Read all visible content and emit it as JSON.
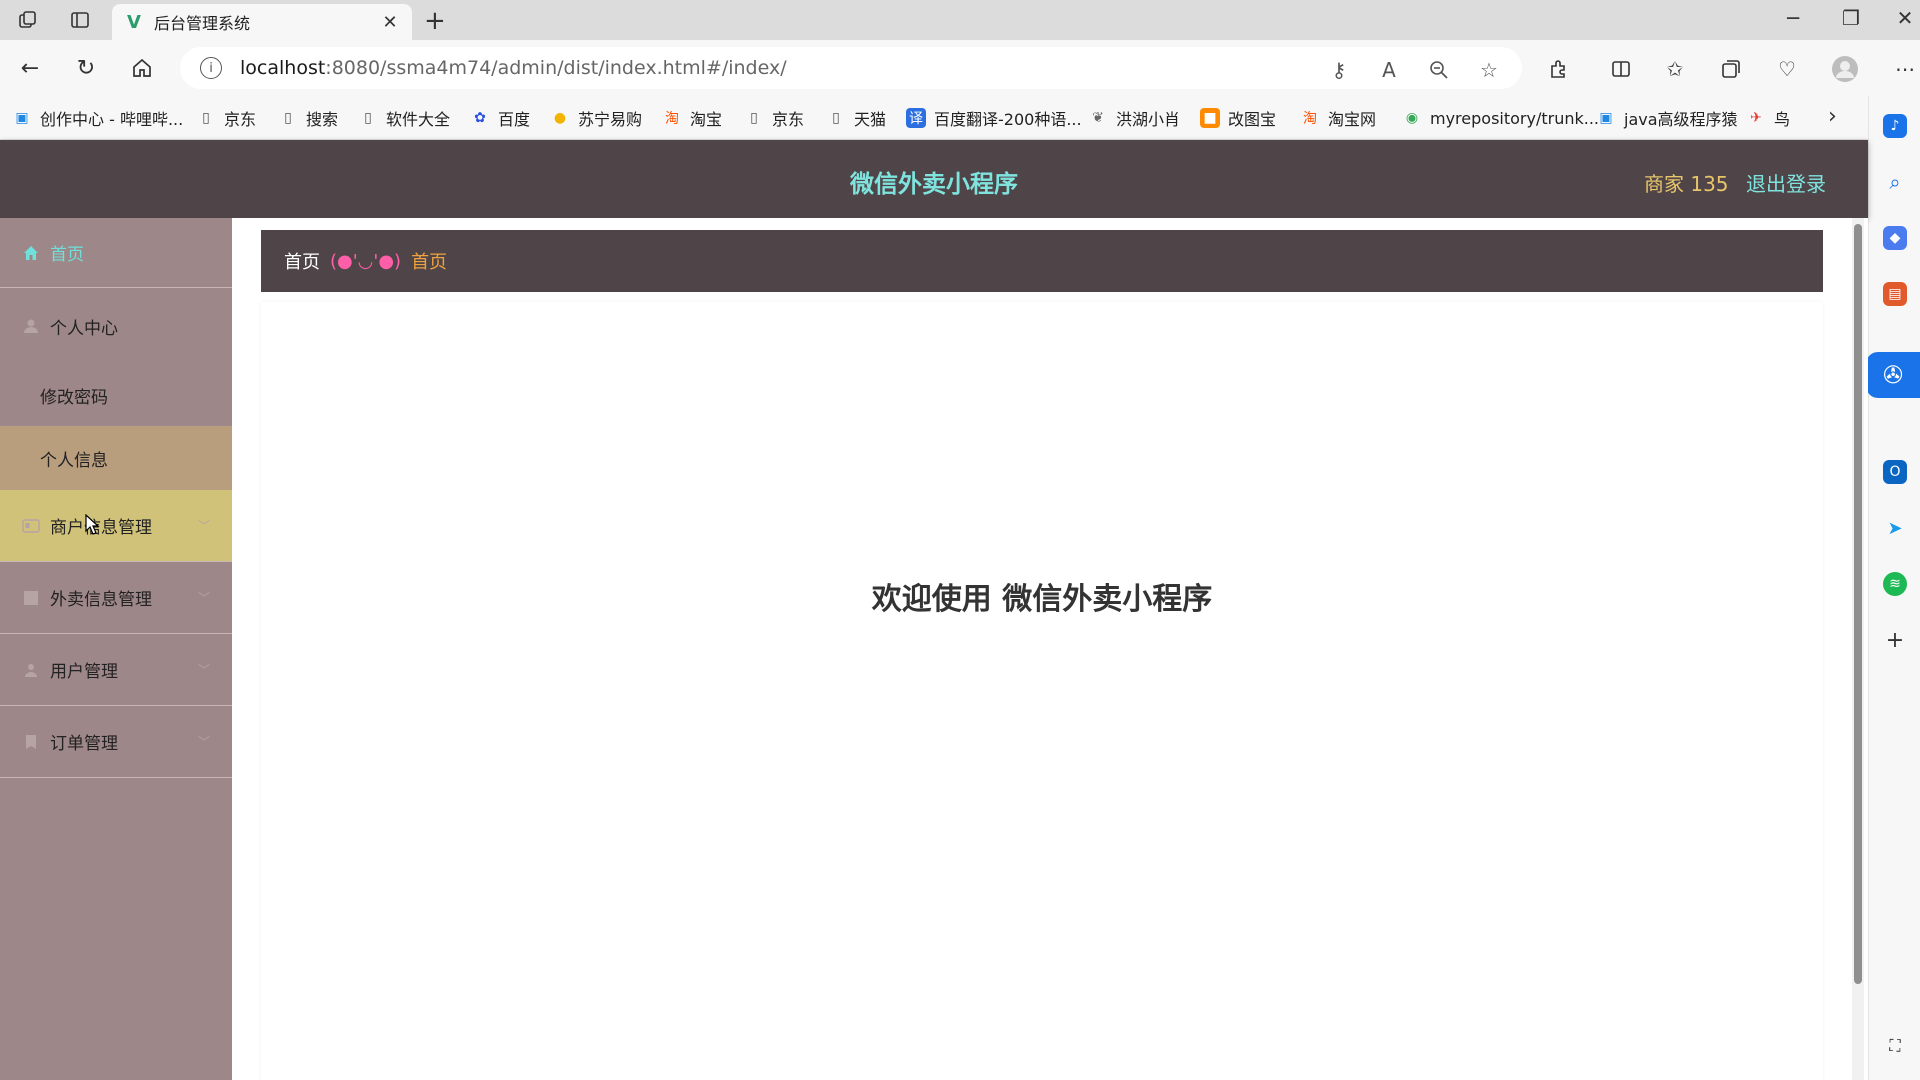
{
  "browser": {
    "tab_title": "后台管理系统",
    "tab_close": "✕",
    "new_tab": "+",
    "url_host": "localhost",
    "url_rest": ":8080/ssma4m74/admin/dist/index.html#/index/",
    "bookmarks": [
      {
        "label": "创作中心 - 哔哩哔...",
        "icon": "bilibili-icon",
        "color": "#1e88e5"
      },
      {
        "label": "京东",
        "icon": "page-icon",
        "color": "#555555"
      },
      {
        "label": "搜索",
        "icon": "page-icon",
        "color": "#555555"
      },
      {
        "label": "软件大全",
        "icon": "page-icon",
        "color": "#555555"
      },
      {
        "label": "百度",
        "icon": "baidu-icon",
        "color": "#2b4fe0"
      },
      {
        "label": "苏宁易购",
        "icon": "suning-icon",
        "color": "#f2b400"
      },
      {
        "label": "淘宝",
        "icon": "taobao-icon",
        "color": "#ff5000"
      },
      {
        "label": "京东",
        "icon": "page-icon",
        "color": "#555555"
      },
      {
        "label": "天猫",
        "icon": "page-icon",
        "color": "#555555"
      },
      {
        "label": "百度翻译-200种语...",
        "icon": "translate-icon",
        "color": "#2b6fe0"
      },
      {
        "label": "洪湖小肖",
        "icon": "bird-icon",
        "color": "#666666"
      },
      {
        "label": "改图宝",
        "icon": "gaitubao-icon",
        "color": "#ff8a00"
      },
      {
        "label": "淘宝网",
        "icon": "taobao-icon",
        "color": "#ff5000"
      },
      {
        "label": "myrepository/trunk...",
        "icon": "chrome-icon",
        "color": "#34a853"
      },
      {
        "label": "java高级程序猿",
        "icon": "bilibili-icon",
        "color": "#1e88e5"
      },
      {
        "label": "鸟",
        "icon": "bird-icon",
        "color": "#e53935"
      }
    ]
  },
  "app": {
    "title": "微信外卖小程序",
    "merchant_label": "商家 135",
    "logout_label": "退出登录"
  },
  "sidebar": {
    "home": "首页",
    "personal_center": "个人中心",
    "change_password": "修改密码",
    "personal_info": "个人信息",
    "merchant_mgmt": "商户信息管理",
    "takeout_mgmt": "外卖信息管理",
    "user_mgmt": "用户管理",
    "order_mgmt": "订单管理"
  },
  "breadcrumb": {
    "home": "首页",
    "separator": "(●'◡'●)",
    "current": "首页"
  },
  "main": {
    "welcome": "欢迎使用 微信外卖小程序"
  },
  "colors": {
    "header_bg": "#4f4549",
    "sidebar_bg": "#9e8788",
    "active_item_bg": "#b99e7e",
    "hover_item_bg": "#d1c27a",
    "title_color": "#7fe3de",
    "merchant_color": "#e8c56a",
    "breadcrumb_current": "#f0a23c"
  }
}
